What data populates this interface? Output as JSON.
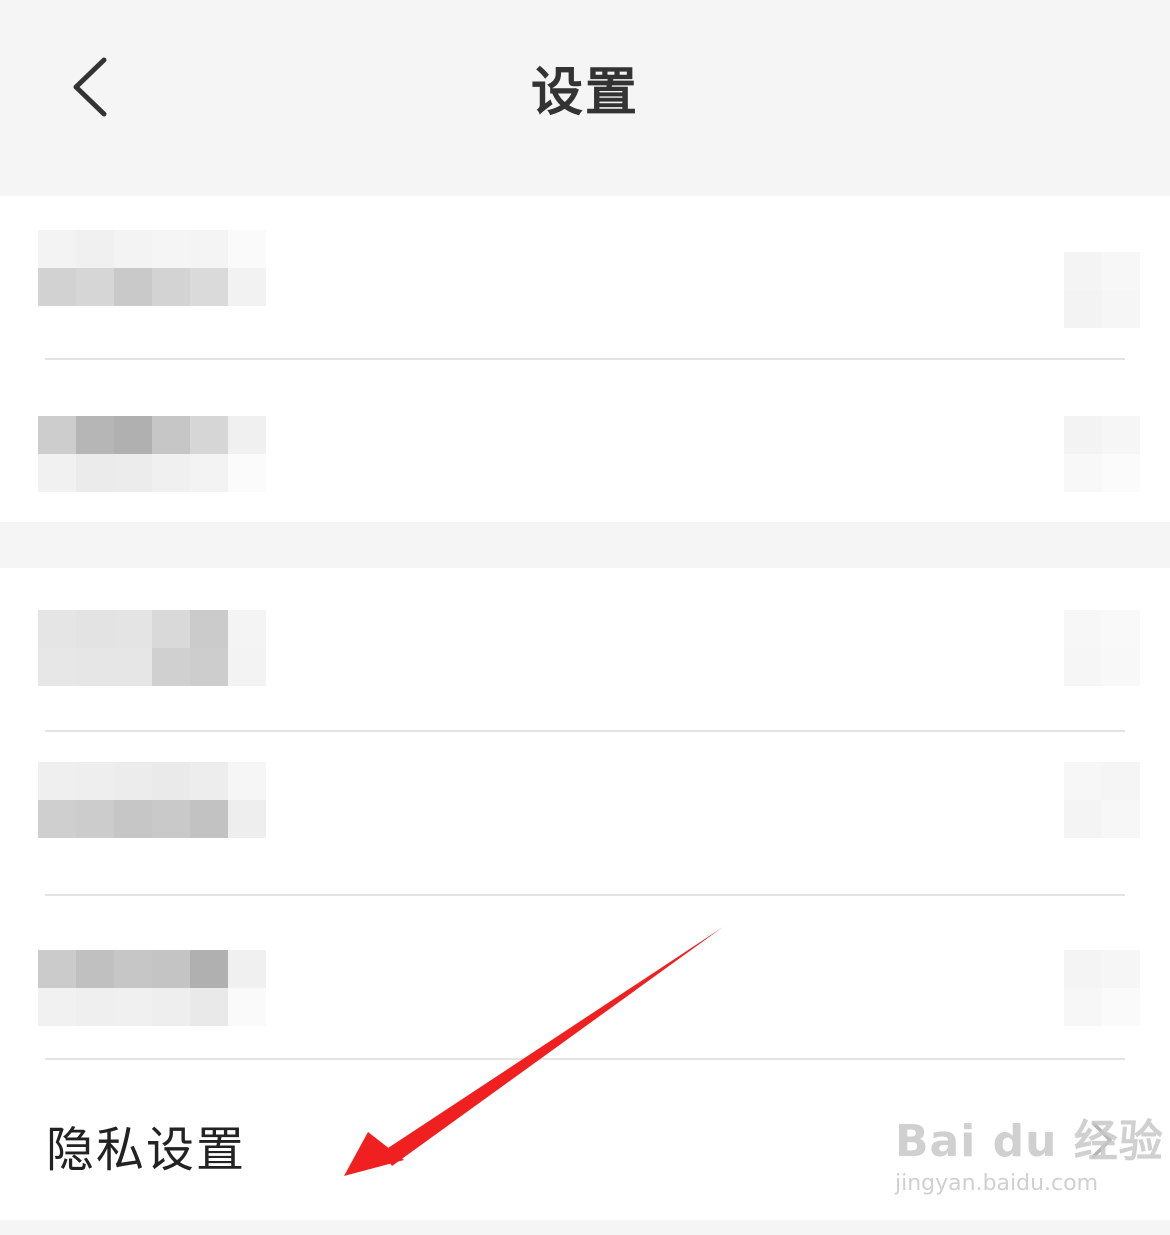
{
  "header": {
    "title": "设置",
    "back_icon": "chevron-left-icon"
  },
  "privacy_row": {
    "label": "隐私设置",
    "chevron_icon": "chevron-right-icon"
  },
  "watermark": {
    "brand": "Bai du 经验",
    "url": "jingyan.baidu.com"
  },
  "annotation": {
    "arrow_color": "#f02020"
  },
  "colors": {
    "background": "#f5f5f5",
    "card": "#ffffff",
    "divider": "#e3e3e3",
    "title": "#333333",
    "label": "#222222"
  }
}
